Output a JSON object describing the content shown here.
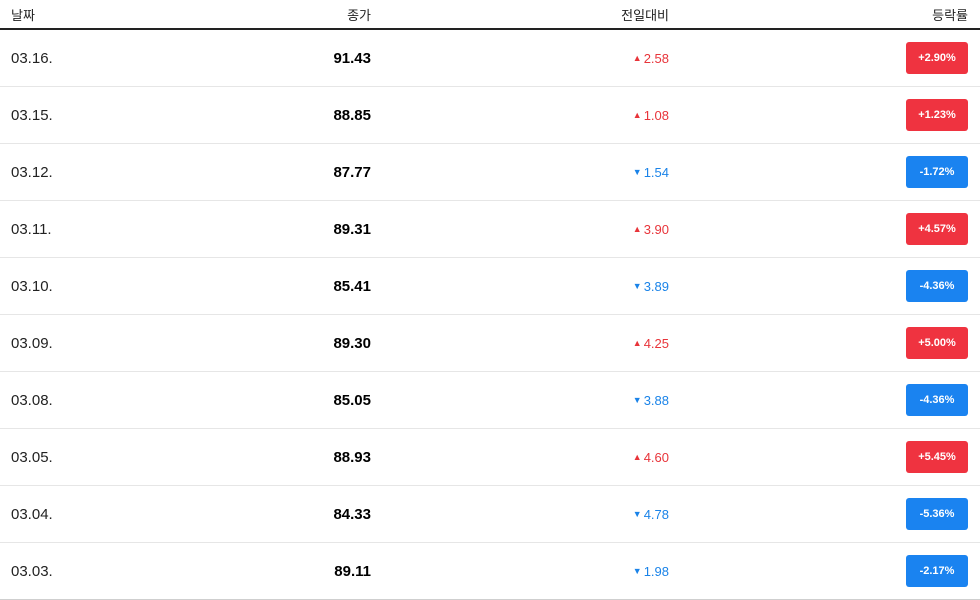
{
  "table": {
    "headers": {
      "date": "날짜",
      "close": "종가",
      "change": "전일대비",
      "rate": "등락률"
    },
    "rows": [
      {
        "date": "03.16.",
        "close": "91.43",
        "direction": "up",
        "arrow": "▲",
        "change": "2.58",
        "rate": "+2.90%"
      },
      {
        "date": "03.15.",
        "close": "88.85",
        "direction": "up",
        "arrow": "▲",
        "change": "1.08",
        "rate": "+1.23%"
      },
      {
        "date": "03.12.",
        "close": "87.77",
        "direction": "down",
        "arrow": "▼",
        "change": "1.54",
        "rate": "-1.72%"
      },
      {
        "date": "03.11.",
        "close": "89.31",
        "direction": "up",
        "arrow": "▲",
        "change": "3.90",
        "rate": "+4.57%"
      },
      {
        "date": "03.10.",
        "close": "85.41",
        "direction": "down",
        "arrow": "▼",
        "change": "3.89",
        "rate": "-4.36%"
      },
      {
        "date": "03.09.",
        "close": "89.30",
        "direction": "up",
        "arrow": "▲",
        "change": "4.25",
        "rate": "+5.00%"
      },
      {
        "date": "03.08.",
        "close": "85.05",
        "direction": "down",
        "arrow": "▼",
        "change": "3.88",
        "rate": "-4.36%"
      },
      {
        "date": "03.05.",
        "close": "88.93",
        "direction": "up",
        "arrow": "▲",
        "change": "4.60",
        "rate": "+5.45%"
      },
      {
        "date": "03.04.",
        "close": "84.33",
        "direction": "down",
        "arrow": "▼",
        "change": "4.78",
        "rate": "-5.36%"
      },
      {
        "date": "03.03.",
        "close": "89.11",
        "direction": "down",
        "arrow": "▼",
        "change": "1.98",
        "rate": "-2.17%"
      }
    ]
  },
  "colors": {
    "up": "#ef3340",
    "down": "#1a83f0"
  }
}
